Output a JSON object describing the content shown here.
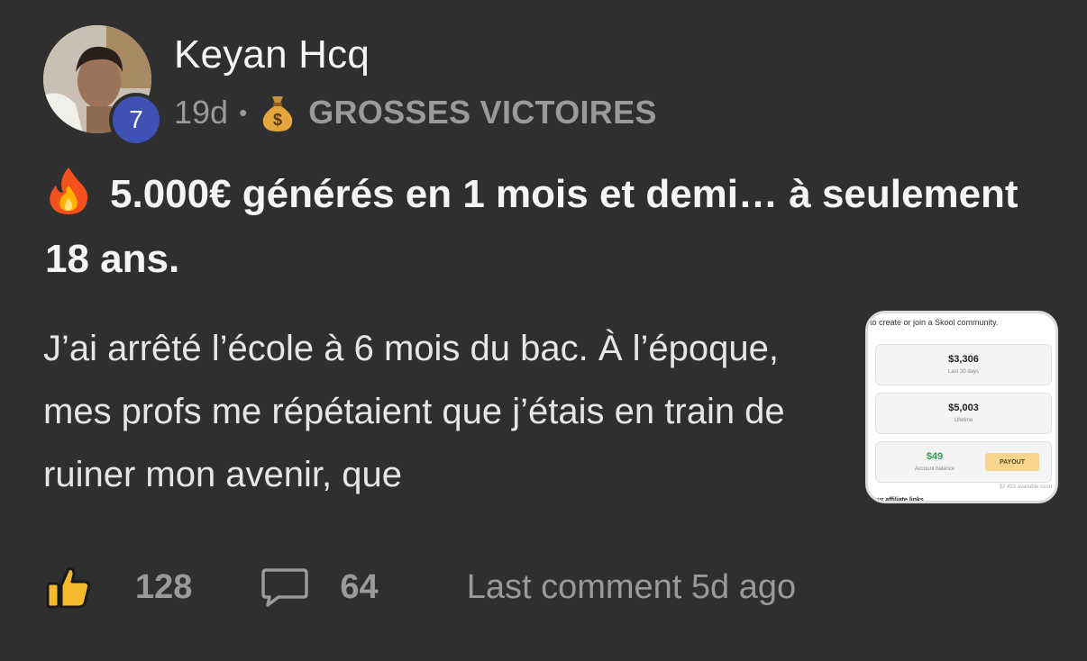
{
  "post": {
    "author": "Keyan Hcq",
    "level": "7",
    "time": "19d",
    "separator": "•",
    "category": "GROSSES VICTOIRES",
    "title": "5.000€ générés en 1 mois et demi… à seulement 18 ans.",
    "body": "J’ai arrêté l’école à 6 mois du bac. À l’époque, mes profs me répétaient que j’étais en train de ruiner mon avenir, que"
  },
  "thumbnail": {
    "top_text": "to create or join a Skool community.",
    "cards": [
      {
        "value": "$3,306",
        "label": "Last 30 days"
      },
      {
        "value": "$5,003",
        "label": "Lifetime"
      },
      {
        "value": "$49",
        "label": "Account balance"
      }
    ],
    "payout_label": "PAYOUT",
    "available": "$2,433 available soon",
    "affiliate": "Your affiliate links"
  },
  "footer": {
    "likes": "128",
    "comments": "64",
    "last_comment": "Last comment 5d ago"
  },
  "icons": {
    "like": "thumbs-up-icon",
    "comment": "speech-bubble-icon",
    "category": "money-bag-icon",
    "title": "fire-icon"
  },
  "colors": {
    "background": "#2f2f2f",
    "level_badge": "#3f51b5",
    "muted_text": "#9a9a9a",
    "thumb_green": "#2e9e4f",
    "payout": "#f7d58c"
  }
}
